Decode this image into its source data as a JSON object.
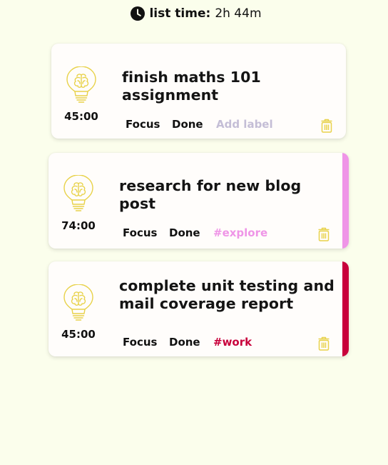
{
  "header": {
    "label": "list time:",
    "value": "2h 44m"
  },
  "tasks": [
    {
      "timer": "45:00",
      "title_lines": [
        "finish maths 101 assignment",
        ""
      ],
      "focus_label": "Focus",
      "done_label": "Done",
      "tag": "Add label",
      "tag_color": "#c4bed6",
      "accent": ""
    },
    {
      "timer": "74:00",
      "title_lines": [
        "research for new blog post",
        ""
      ],
      "focus_label": "Focus",
      "done_label": "Done",
      "tag": "#explore",
      "tag_color": "#ef95e7",
      "accent": "#ef95e7"
    },
    {
      "timer": "45:00",
      "title_lines": [
        "complete unit testing and",
        "mail coverage report"
      ],
      "focus_label": "Focus",
      "done_label": "Done",
      "tag": "#work",
      "tag_color": "#c8003b",
      "accent": "#c8003b"
    }
  ],
  "icons": {
    "clock": "clock-icon",
    "bulb": "lightbulb-brain-icon",
    "trash": "trash-icon"
  },
  "colors": {
    "background": "#fbfeec",
    "icon_yellow": "#e8d24a"
  }
}
